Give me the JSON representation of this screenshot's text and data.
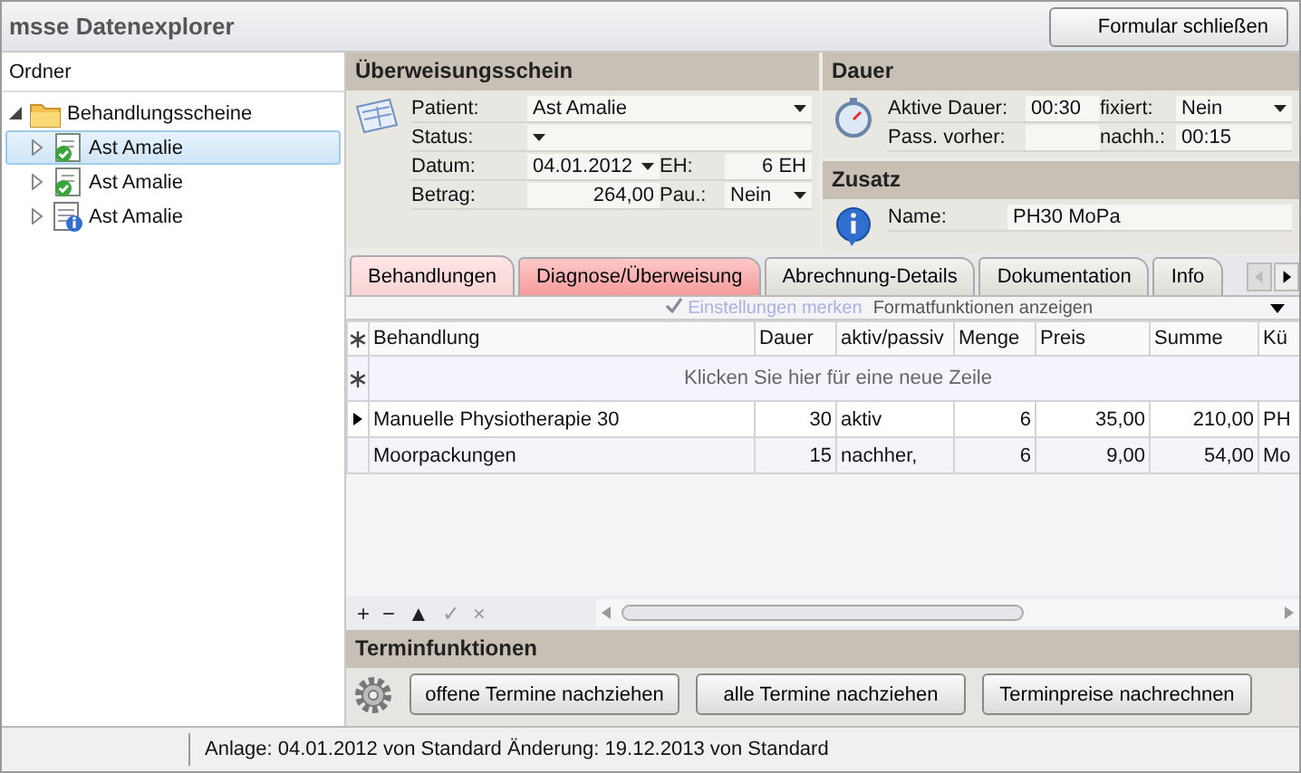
{
  "window": {
    "title": "msse Datenexplorer",
    "close_button": "Formular schließen"
  },
  "sidebar": {
    "heading": "Ordner",
    "tree": [
      {
        "label": "Behandlungsscheine",
        "kind": "folder",
        "expanded": true,
        "selected": false,
        "children": [
          {
            "label": "Ast Amalie",
            "kind": "done",
            "expanded": false,
            "selected": true
          },
          {
            "label": "Ast Amalie",
            "kind": "done",
            "expanded": false,
            "selected": false
          },
          {
            "label": "Ast Amalie",
            "kind": "info",
            "expanded": false,
            "selected": false
          }
        ]
      }
    ]
  },
  "referral": {
    "title": "Überweisungsschein",
    "rows": [
      [
        {
          "label": "Patient:",
          "value": "Ast Amalie",
          "dropdown": true
        }
      ],
      [
        {
          "label": "Status:",
          "dropdown": true
        }
      ],
      [
        {
          "label": "Datum:",
          "value": "04.01.2012",
          "dropdown": true
        },
        {
          "label": "EH:",
          "value": "6 EH",
          "numeric": true
        }
      ],
      [
        {
          "label": "Betrag:",
          "value": "264,00",
          "numeric": true
        },
        {
          "label": "Pau.:",
          "value": "Nein",
          "dropdown": true
        }
      ]
    ]
  },
  "duration": {
    "title": "Dauer",
    "rows": [
      [
        {
          "label": "Aktive Dauer:",
          "value": "00:30"
        },
        {
          "label": "fixiert:",
          "value": "Nein",
          "dropdown": true
        }
      ],
      [
        {
          "label": "Pass. vorher:"
        },
        {
          "label": "nachh.:",
          "value": "00:15"
        }
      ]
    ]
  },
  "extra": {
    "title": "Zusatz",
    "rows": [
      [
        {
          "label": "Name:",
          "value": "PH30 MoPa"
        }
      ]
    ]
  },
  "tabs": [
    {
      "label": "Behandlungen",
      "selected": true,
      "warning": false
    },
    {
      "label": "Diagnose/Überweisung",
      "selected": false,
      "warning": true
    },
    {
      "label": "Abrechnung-Details",
      "selected": false,
      "warning": false
    },
    {
      "label": "Dokumentation",
      "selected": false,
      "warning": false
    },
    {
      "label": "Info",
      "selected": false,
      "warning": false
    }
  ],
  "grid_options": {
    "remember": {
      "label": "Einstellungen merken",
      "checked": true,
      "disabled": true
    },
    "format": {
      "label": "Formatfunktionen anzeigen"
    }
  },
  "table": {
    "columns": [
      "Behandlung",
      "Dauer",
      "aktiv/passiv",
      "Menge",
      "Preis",
      "Summe",
      "Kü"
    ],
    "new_row_hint": "Klicken Sie hier für eine neue Zeile",
    "rows": [
      {
        "selected": true,
        "cells": [
          "Manuelle Physiotherapie 30",
          "30",
          "aktiv",
          "6",
          "35,00",
          "210,00",
          "PH"
        ]
      },
      {
        "selected": false,
        "cells": [
          "Moorpackungen",
          "15",
          "nachher,",
          "6",
          "9,00",
          "54,00",
          "Mo"
        ]
      }
    ]
  },
  "navigator": [
    {
      "symbol": "+",
      "disabled": false
    },
    {
      "symbol": "−",
      "disabled": false
    },
    {
      "symbol": "▲",
      "disabled": false
    },
    {
      "symbol": "✓",
      "disabled": true
    },
    {
      "symbol": "×",
      "disabled": true
    }
  ],
  "appointments": {
    "title": "Terminfunktionen",
    "buttons": [
      "offene Termine nachziehen",
      "alle Termine nachziehen",
      "Terminpreise nachrechnen"
    ]
  },
  "status_bar": {
    "text": "Anlage: 04.01.2012 von Standard  Änderung: 19.12.2013 von Standard"
  }
}
